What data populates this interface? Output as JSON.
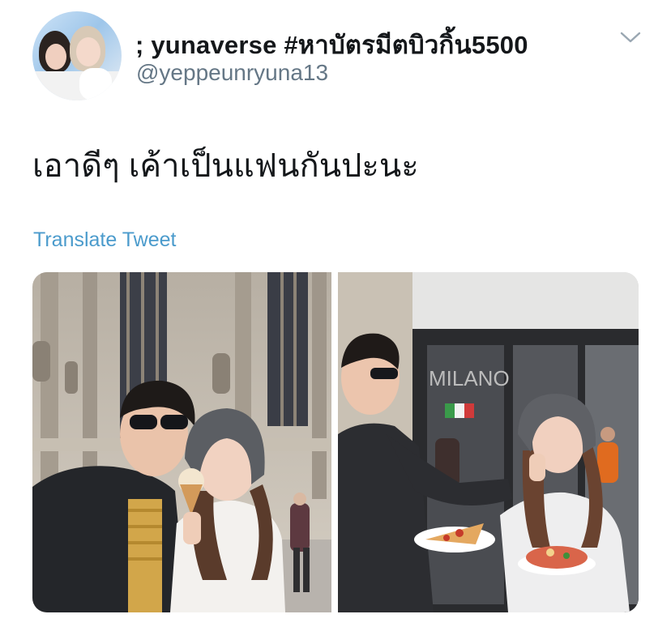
{
  "tweet": {
    "display_name": "; yunaverse #หาบัตรมีตบิวกิ้น5500",
    "handle": "@yeppeunryuna13",
    "text": "เอาดีๆ เค้าเป็นแฟนกันปะนะ",
    "translate_label": "Translate Tweet"
  },
  "media": {
    "left_photo": {
      "subject": "couple-in-front-of-cathedral"
    },
    "right_photo": {
      "subject": "couple-with-pizza-at-storefront",
      "storefront_sign": "MILANO"
    }
  },
  "icons": {
    "menu": "chevron-down-icon"
  },
  "colors": {
    "name": "#14171a",
    "handle": "#657786",
    "link": "#4b9bcc"
  }
}
